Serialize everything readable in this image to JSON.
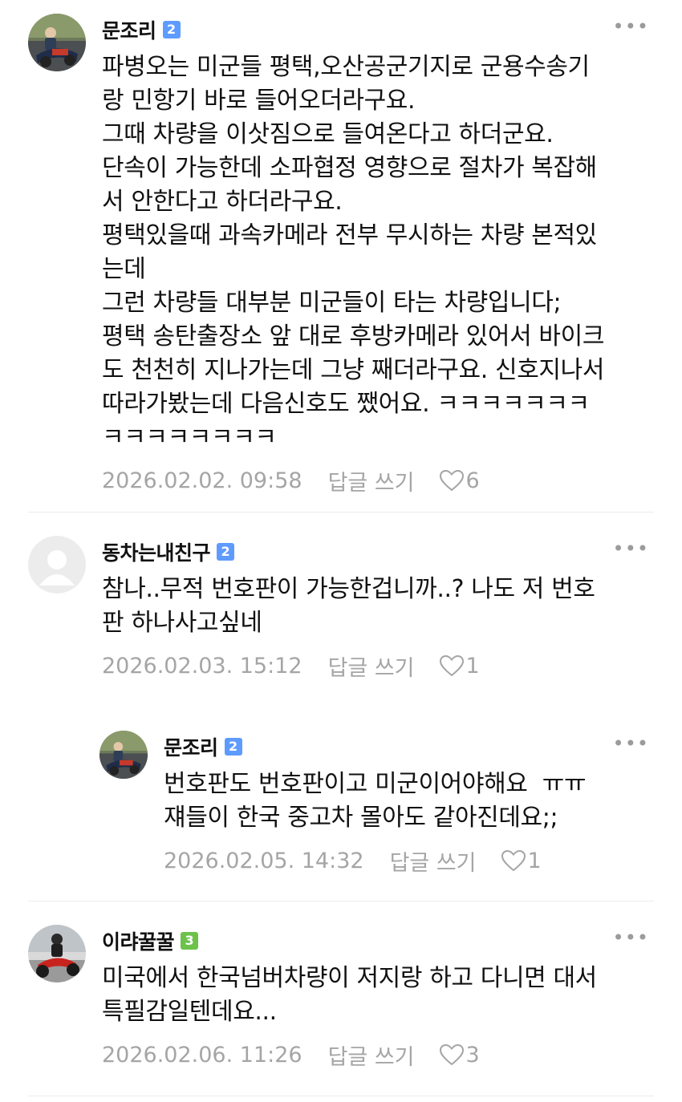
{
  "comments": [
    {
      "author": "문조리",
      "level": "2",
      "level_color": "#5e9bff",
      "text": "파병오는 미군들 평택,오산공군기지로 군용수송기\n랑 민항기 바로 들어오더라구요.\n그때 차량을 이삿짐으로 들여온다고 하더군요.\n단속이 가능한데 소파협정 영향으로 절차가 복잡해\n서 안한다고 하더라구요.\n평택있을때 과속카메라 전부 무시하는 차량 본적있\n는데\n그런 차량들 대부분 미군들이 타는 차량입니다;\n평택 송탄출장소 앞 대로 후방카메라 있어서 바이크\n도 천천히 지나가는데 그냥 째더라구요. 신호지나서\n따라가봤는데 다음신호도 쨌어요. ㅋㅋㅋㅋㅋㅋㅋ\nㅋㅋㅋㅋㅋㅋㅋㅋ",
      "date": "2026.02.02. 09:58",
      "reply_label": "답글 쓰기",
      "likes": "6",
      "more": "•••",
      "avatar": "motorcycle-rider-avatar"
    },
    {
      "author": "동차는내친구",
      "level": "2",
      "level_color": "#5e9bff",
      "text": "참나..무적 번호판이 가능한겁니까..? 나도 저 번호\n판 하나사고싶네",
      "date": "2026.02.03. 15:12",
      "reply_label": "답글 쓰기",
      "likes": "1",
      "more": "•••",
      "avatar": "default-person-avatar"
    },
    {
      "author": "문조리",
      "level": "2",
      "level_color": "#5e9bff",
      "text": "번호판도 번호판이고 미군이어야해요  ㅠㅠ\n쟤들이 한국 중고차 몰아도 같아진데요;;",
      "date": "2026.02.05. 14:32",
      "reply_label": "답글 쓰기",
      "likes": "1",
      "more": "•••",
      "avatar": "motorcycle-rider-avatar"
    },
    {
      "author": "이랴꿀꿀",
      "level": "3",
      "level_color": "#6cc24a",
      "text": "미국에서 한국넘버차량이 저지랑 하고 다니면 대서\n특필감일텐데요...",
      "date": "2026.02.06. 11:26",
      "reply_label": "답글 쓰기",
      "likes": "3",
      "more": "•••",
      "avatar": "red-motorcycle-avatar"
    }
  ]
}
